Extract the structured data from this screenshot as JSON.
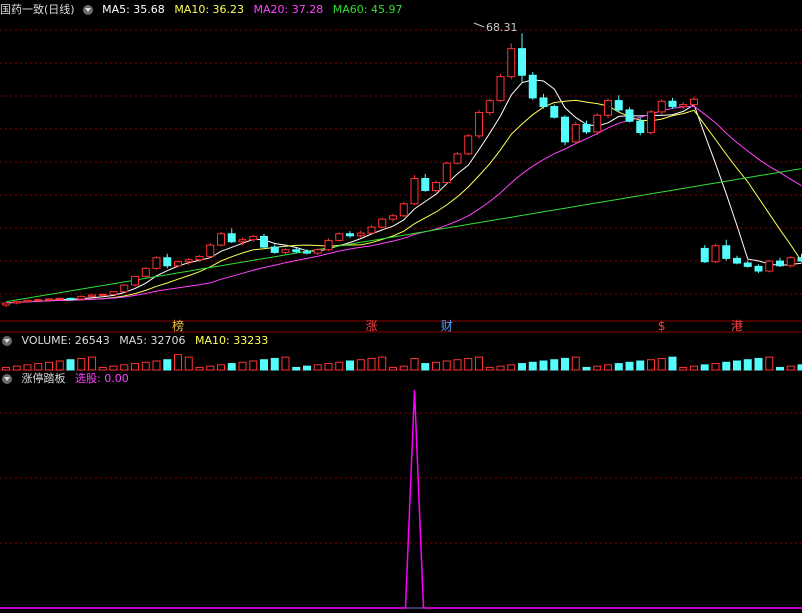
{
  "main": {
    "title": "国药一致",
    "period": "(日线)",
    "ma": [
      {
        "label": "MA5: 35.68",
        "color": "#ffffff"
      },
      {
        "label": "MA10: 36.23",
        "color": "#ffff55"
      },
      {
        "label": "MA20: 37.28",
        "color": "#ff44ff"
      },
      {
        "label": "MA60: 45.97",
        "color": "#33dd33"
      }
    ],
    "peak_label": "68.31"
  },
  "volume": {
    "label": "VOLUME: 26543",
    "ma5": "MA5: 32706",
    "ma10": "MA10: 33233"
  },
  "indicator": {
    "name": "涨停踏板",
    "signal": "选股: 0.00"
  },
  "markers": [
    {
      "text": "榜",
      "color": "#f0c040"
    },
    {
      "text": "涨",
      "color": "#ff4040"
    },
    {
      "text": "财",
      "color": "#50a0ff"
    },
    {
      "text": "$",
      "color": "#ff4040"
    },
    {
      "text": "港",
      "color": "#ff4040"
    }
  ],
  "colors": {
    "up": "#ff3232",
    "down": "#54fcfc",
    "grid": "#8b0000",
    "signal": "#ff00ff"
  },
  "chart_data": {
    "type": "candlestick",
    "price_ylim": [
      26,
      70
    ],
    "candles": [
      [
        27.5,
        27.9,
        27.2,
        27.8
      ],
      [
        27.8,
        28.1,
        27.6,
        28.0
      ],
      [
        28.0,
        28.3,
        27.8,
        28.2
      ],
      [
        28.2,
        28.4,
        28.0,
        28.3
      ],
      [
        28.3,
        28.5,
        28.1,
        28.4
      ],
      [
        28.4,
        28.6,
        28.2,
        28.5
      ],
      [
        28.5,
        28.6,
        28.2,
        28.3
      ],
      [
        28.4,
        28.9,
        28.3,
        28.8
      ],
      [
        28.8,
        29.1,
        28.6,
        29.0
      ],
      [
        29.0,
        29.2,
        28.8,
        29.1
      ],
      [
        29.1,
        29.6,
        29.0,
        29.5
      ],
      [
        29.5,
        30.6,
        29.4,
        30.5
      ],
      [
        30.5,
        31.9,
        30.3,
        31.8
      ],
      [
        31.8,
        33.2,
        31.6,
        33.0
      ],
      [
        33.0,
        34.8,
        32.8,
        34.6
      ],
      [
        34.6,
        35.2,
        33.0,
        33.4
      ],
      [
        33.4,
        34.2,
        33.1,
        34.0
      ],
      [
        34.0,
        34.6,
        33.5,
        34.3
      ],
      [
        34.3,
        35.0,
        34.0,
        34.8
      ],
      [
        34.8,
        36.8,
        34.6,
        36.5
      ],
      [
        36.5,
        38.5,
        36.3,
        38.2
      ],
      [
        38.2,
        39.0,
        36.8,
        37.0
      ],
      [
        37.0,
        37.6,
        36.5,
        37.3
      ],
      [
        37.3,
        38.0,
        37.0,
        37.8
      ],
      [
        37.8,
        38.2,
        36.0,
        36.2
      ],
      [
        36.2,
        36.6,
        35.2,
        35.4
      ],
      [
        35.4,
        36.0,
        35.0,
        35.8
      ],
      [
        35.8,
        36.1,
        35.3,
        35.5
      ],
      [
        35.5,
        35.9,
        35.1,
        35.3
      ],
      [
        35.3,
        36.0,
        35.0,
        35.8
      ],
      [
        35.8,
        37.5,
        35.6,
        37.2
      ],
      [
        37.2,
        38.4,
        37.0,
        38.2
      ],
      [
        38.2,
        38.6,
        37.6,
        37.9
      ],
      [
        37.9,
        38.7,
        37.6,
        38.3
      ],
      [
        38.3,
        39.5,
        38.0,
        39.2
      ],
      [
        39.2,
        40.6,
        39.0,
        40.4
      ],
      [
        40.4,
        41.2,
        40.0,
        40.9
      ],
      [
        40.9,
        43.0,
        40.7,
        42.7
      ],
      [
        42.7,
        47.0,
        42.5,
        46.5
      ],
      [
        46.5,
        47.2,
        44.5,
        44.7
      ],
      [
        44.7,
        46.2,
        44.4,
        45.9
      ],
      [
        45.9,
        49.0,
        45.7,
        48.8
      ],
      [
        48.8,
        50.5,
        48.6,
        50.2
      ],
      [
        50.2,
        53.2,
        50.0,
        52.9
      ],
      [
        52.9,
        56.8,
        52.5,
        56.4
      ],
      [
        56.4,
        58.5,
        56.0,
        58.2
      ],
      [
        58.2,
        62.2,
        58.0,
        61.8
      ],
      [
        61.8,
        66.8,
        61.4,
        66.0
      ],
      [
        66.0,
        68.3,
        61.0,
        62.0
      ],
      [
        62.0,
        62.5,
        58.3,
        58.6
      ],
      [
        58.6,
        59.2,
        57.0,
        57.3
      ],
      [
        57.3,
        57.6,
        55.5,
        55.7
      ],
      [
        55.7,
        56.0,
        51.5,
        52.0
      ],
      [
        52.0,
        55.0,
        51.7,
        54.6
      ],
      [
        54.6,
        55.2,
        53.2,
        53.5
      ],
      [
        53.5,
        56.3,
        53.0,
        56.0
      ],
      [
        56.0,
        58.5,
        55.6,
        58.2
      ],
      [
        58.2,
        59.0,
        56.5,
        56.8
      ],
      [
        56.8,
        57.2,
        54.9,
        55.1
      ],
      [
        55.1,
        55.6,
        53.0,
        53.4
      ],
      [
        53.4,
        56.8,
        53.1,
        56.5
      ],
      [
        56.5,
        58.4,
        56.1,
        58.1
      ],
      [
        58.1,
        58.6,
        57.0,
        57.3
      ],
      [
        57.3,
        58.0,
        56.9,
        57.6
      ],
      [
        57.6,
        58.8,
        57.3,
        58.4
      ],
      [
        36.0,
        36.5,
        33.8,
        34.0
      ],
      [
        34.0,
        36.7,
        33.8,
        36.4
      ],
      [
        36.4,
        37.3,
        34.2,
        34.5
      ],
      [
        34.5,
        34.9,
        33.6,
        33.8
      ],
      [
        33.8,
        34.2,
        33.1,
        33.3
      ],
      [
        33.3,
        33.6,
        32.3,
        32.6
      ],
      [
        32.6,
        34.3,
        32.4,
        34.1
      ],
      [
        34.1,
        34.6,
        33.2,
        33.4
      ],
      [
        33.4,
        34.8,
        33.1,
        34.6
      ],
      [
        34.6,
        35.2,
        33.9,
        34.1
      ]
    ],
    "volume_ylim": [
      0,
      14
    ],
    "signal_values": [
      0,
      0,
      0,
      0,
      0,
      0,
      0,
      0,
      0,
      0,
      0,
      0,
      0,
      0,
      0,
      0,
      0,
      0,
      0,
      0,
      0,
      0,
      0,
      0,
      0,
      0,
      0,
      0,
      0,
      0,
      0,
      0,
      0,
      0,
      0,
      0,
      0,
      0,
      1,
      0,
      0,
      0,
      0,
      0,
      0,
      0,
      0,
      0,
      0,
      0,
      0,
      0,
      0,
      0,
      0,
      0,
      0,
      0,
      0,
      0,
      0,
      0,
      0,
      0,
      0,
      0,
      0,
      0,
      0,
      0,
      0,
      0,
      0,
      0,
      0
    ]
  }
}
